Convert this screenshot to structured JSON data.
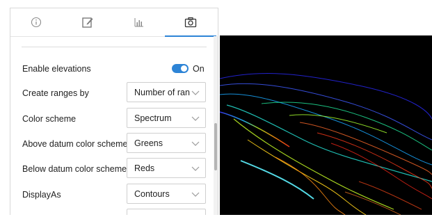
{
  "tabs": [
    {
      "name": "info",
      "icon": "info-icon"
    },
    {
      "name": "edit",
      "icon": "edit-icon"
    },
    {
      "name": "chart",
      "icon": "chart-icon"
    },
    {
      "name": "camera",
      "icon": "camera-icon",
      "active": true
    }
  ],
  "settings": {
    "enable_elevations": {
      "label": "Enable elevations",
      "state": "On",
      "enabled": true
    },
    "create_ranges_by": {
      "label": "Create ranges by",
      "value": "Number of rang"
    },
    "color_scheme": {
      "label": "Color scheme",
      "value": "Spectrum"
    },
    "above_datum": {
      "label": "Above datum color scheme",
      "value": "Greens"
    },
    "below_datum": {
      "label": "Below datum color scheme",
      "value": "Reds"
    },
    "display_as": {
      "label": "DisplayAs",
      "value": "Contours"
    }
  },
  "colors": {
    "accent": "#2d84d6",
    "viewer_bg": "#000000"
  }
}
